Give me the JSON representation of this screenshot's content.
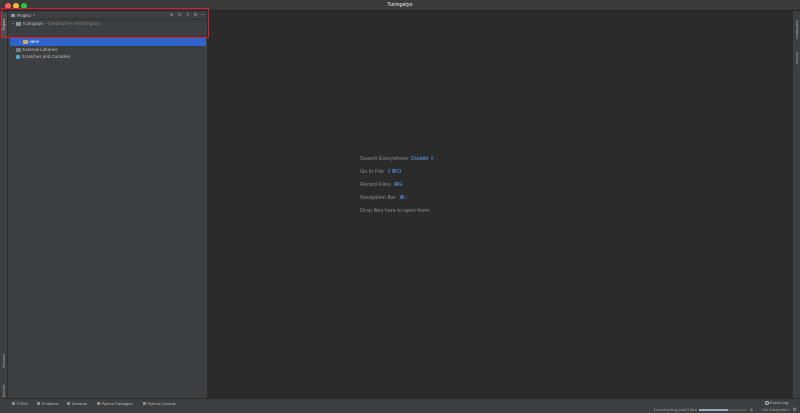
{
  "window": {
    "title": "Turingalyo"
  },
  "left_strip": {
    "project_tab": "Project",
    "structure_tab": "Structure",
    "favorites_tab": "Favorites"
  },
  "right_strip": {
    "notifications_tab": "Notifications",
    "sciview_tab": "SciView"
  },
  "project_panel": {
    "header_title": "Project",
    "header_caret": "▾",
    "tools": [
      "⊕",
      "⇅",
      "⇕",
      "⚙",
      "—"
    ],
    "tree": {
      "root": {
        "arrow": "▾",
        "name": "Turingalyo",
        "path": "~/Desktop/HA-M/Turingalyo"
      },
      "venv": {
        "arrow": "›",
        "name": "venv"
      },
      "external": {
        "arrow": "›",
        "name": "External Libraries"
      },
      "scratches": {
        "arrow": "›",
        "name": "Scratches and Consoles"
      }
    }
  },
  "editor": {
    "hints": [
      {
        "label": "Search Everywhere",
        "key": "Double ⇧"
      },
      {
        "label": "Go to File",
        "key": "⇧⌘O"
      },
      {
        "label": "Recent Files",
        "key": "⌘E"
      },
      {
        "label": "Navigation Bar",
        "key": "⌘↑"
      },
      {
        "label": "Drop files here to open them",
        "key": ""
      }
    ]
  },
  "statusbar": {
    "tools": [
      "TODO",
      "Problems",
      "Terminal",
      "Python Packages",
      "Python Console"
    ],
    "event_log": "Event Log",
    "progress_label": "Downloading pack3 files",
    "progress_fraction": 0.6,
    "progress_cancel": "⊗",
    "interpreter": "<No interpreter>",
    "settings_icon": "⚙"
  }
}
